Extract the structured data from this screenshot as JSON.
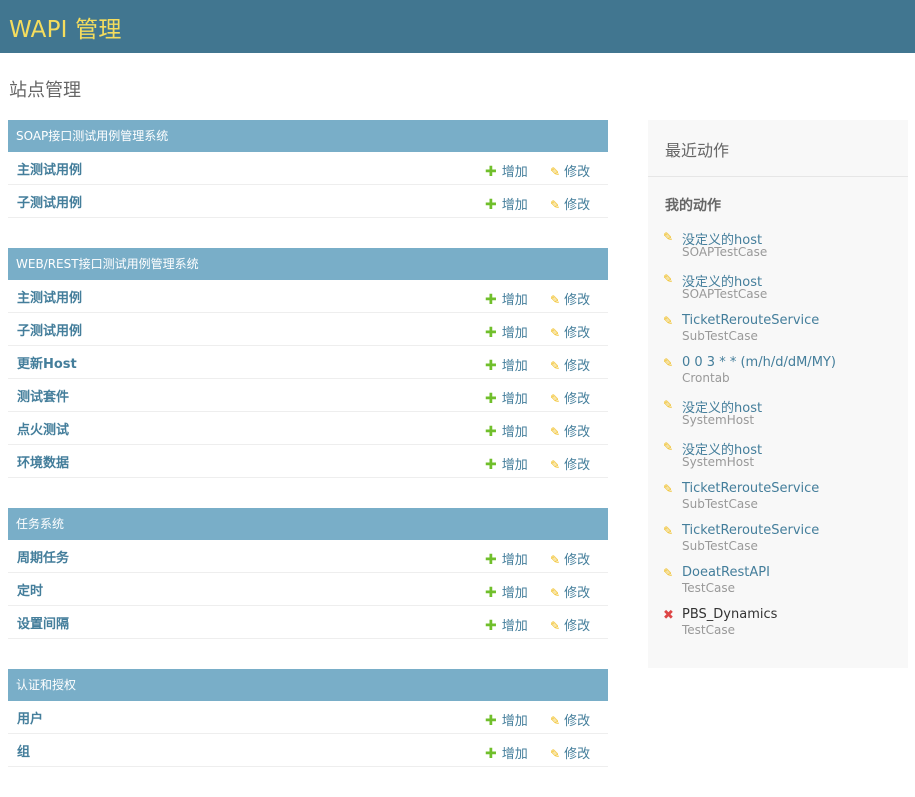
{
  "header": {
    "site_name": "WAPI 管理"
  },
  "page": {
    "title": "站点管理"
  },
  "modules": [
    {
      "caption": "SOAP接口测试用例管理系统",
      "models": [
        {
          "name": "主测试用例",
          "add": "增加",
          "change": "修改"
        },
        {
          "name": "子测试用例",
          "add": "增加",
          "change": "修改"
        }
      ]
    },
    {
      "caption": "WEB/REST接口测试用例管理系统",
      "models": [
        {
          "name": "主测试用例",
          "add": "增加",
          "change": "修改"
        },
        {
          "name": "子测试用例",
          "add": "增加",
          "change": "修改"
        },
        {
          "name": "更新Host",
          "add": "增加",
          "change": "修改"
        },
        {
          "name": "测试套件",
          "add": "增加",
          "change": "修改"
        },
        {
          "name": "点火测试",
          "add": "增加",
          "change": "修改"
        },
        {
          "name": "环境数据",
          "add": "增加",
          "change": "修改"
        }
      ]
    },
    {
      "caption": "任务系统",
      "models": [
        {
          "name": "周期任务",
          "add": "增加",
          "change": "修改"
        },
        {
          "name": "定时",
          "add": "增加",
          "change": "修改"
        },
        {
          "name": "设置间隔",
          "add": "增加",
          "change": "修改"
        }
      ]
    },
    {
      "caption": "认证和授权",
      "models": [
        {
          "name": "用户",
          "add": "增加",
          "change": "修改"
        },
        {
          "name": "组",
          "add": "增加",
          "change": "修改"
        }
      ]
    }
  ],
  "sidebar": {
    "title": "最近动作",
    "subtitle": "我的动作",
    "actions": [
      {
        "label": "没定义的host",
        "type": "SOAPTestCase",
        "icon": "pencil-icon"
      },
      {
        "label": "没定义的host",
        "type": "SOAPTestCase",
        "icon": "pencil-icon"
      },
      {
        "label": "TicketRerouteService",
        "type": "SubTestCase",
        "icon": "pencil-icon"
      },
      {
        "label": "0 0 3 * * (m/h/d/dM/MY)",
        "type": "Crontab",
        "icon": "pencil-icon"
      },
      {
        "label": "没定义的host",
        "type": "SystemHost",
        "icon": "pencil-icon"
      },
      {
        "label": "没定义的host",
        "type": "SystemHost",
        "icon": "pencil-icon"
      },
      {
        "label": "TicketRerouteService",
        "type": "SubTestCase",
        "icon": "pencil-icon"
      },
      {
        "label": "TicketRerouteService",
        "type": "SubTestCase",
        "icon": "pencil-icon"
      },
      {
        "label": "DoeatRestAPI",
        "type": "TestCase",
        "icon": "pencil-icon"
      },
      {
        "label": "PBS_Dynamics",
        "type": "TestCase",
        "icon": "delete-icon"
      }
    ]
  },
  "colors": {
    "header_bg": "#417690",
    "site_name": "#f5dd5d",
    "caption_bg": "#79aec8",
    "link": "#447e9b",
    "add": "#70bf2b",
    "change": "#efb80b",
    "delete": "#dd4646"
  }
}
